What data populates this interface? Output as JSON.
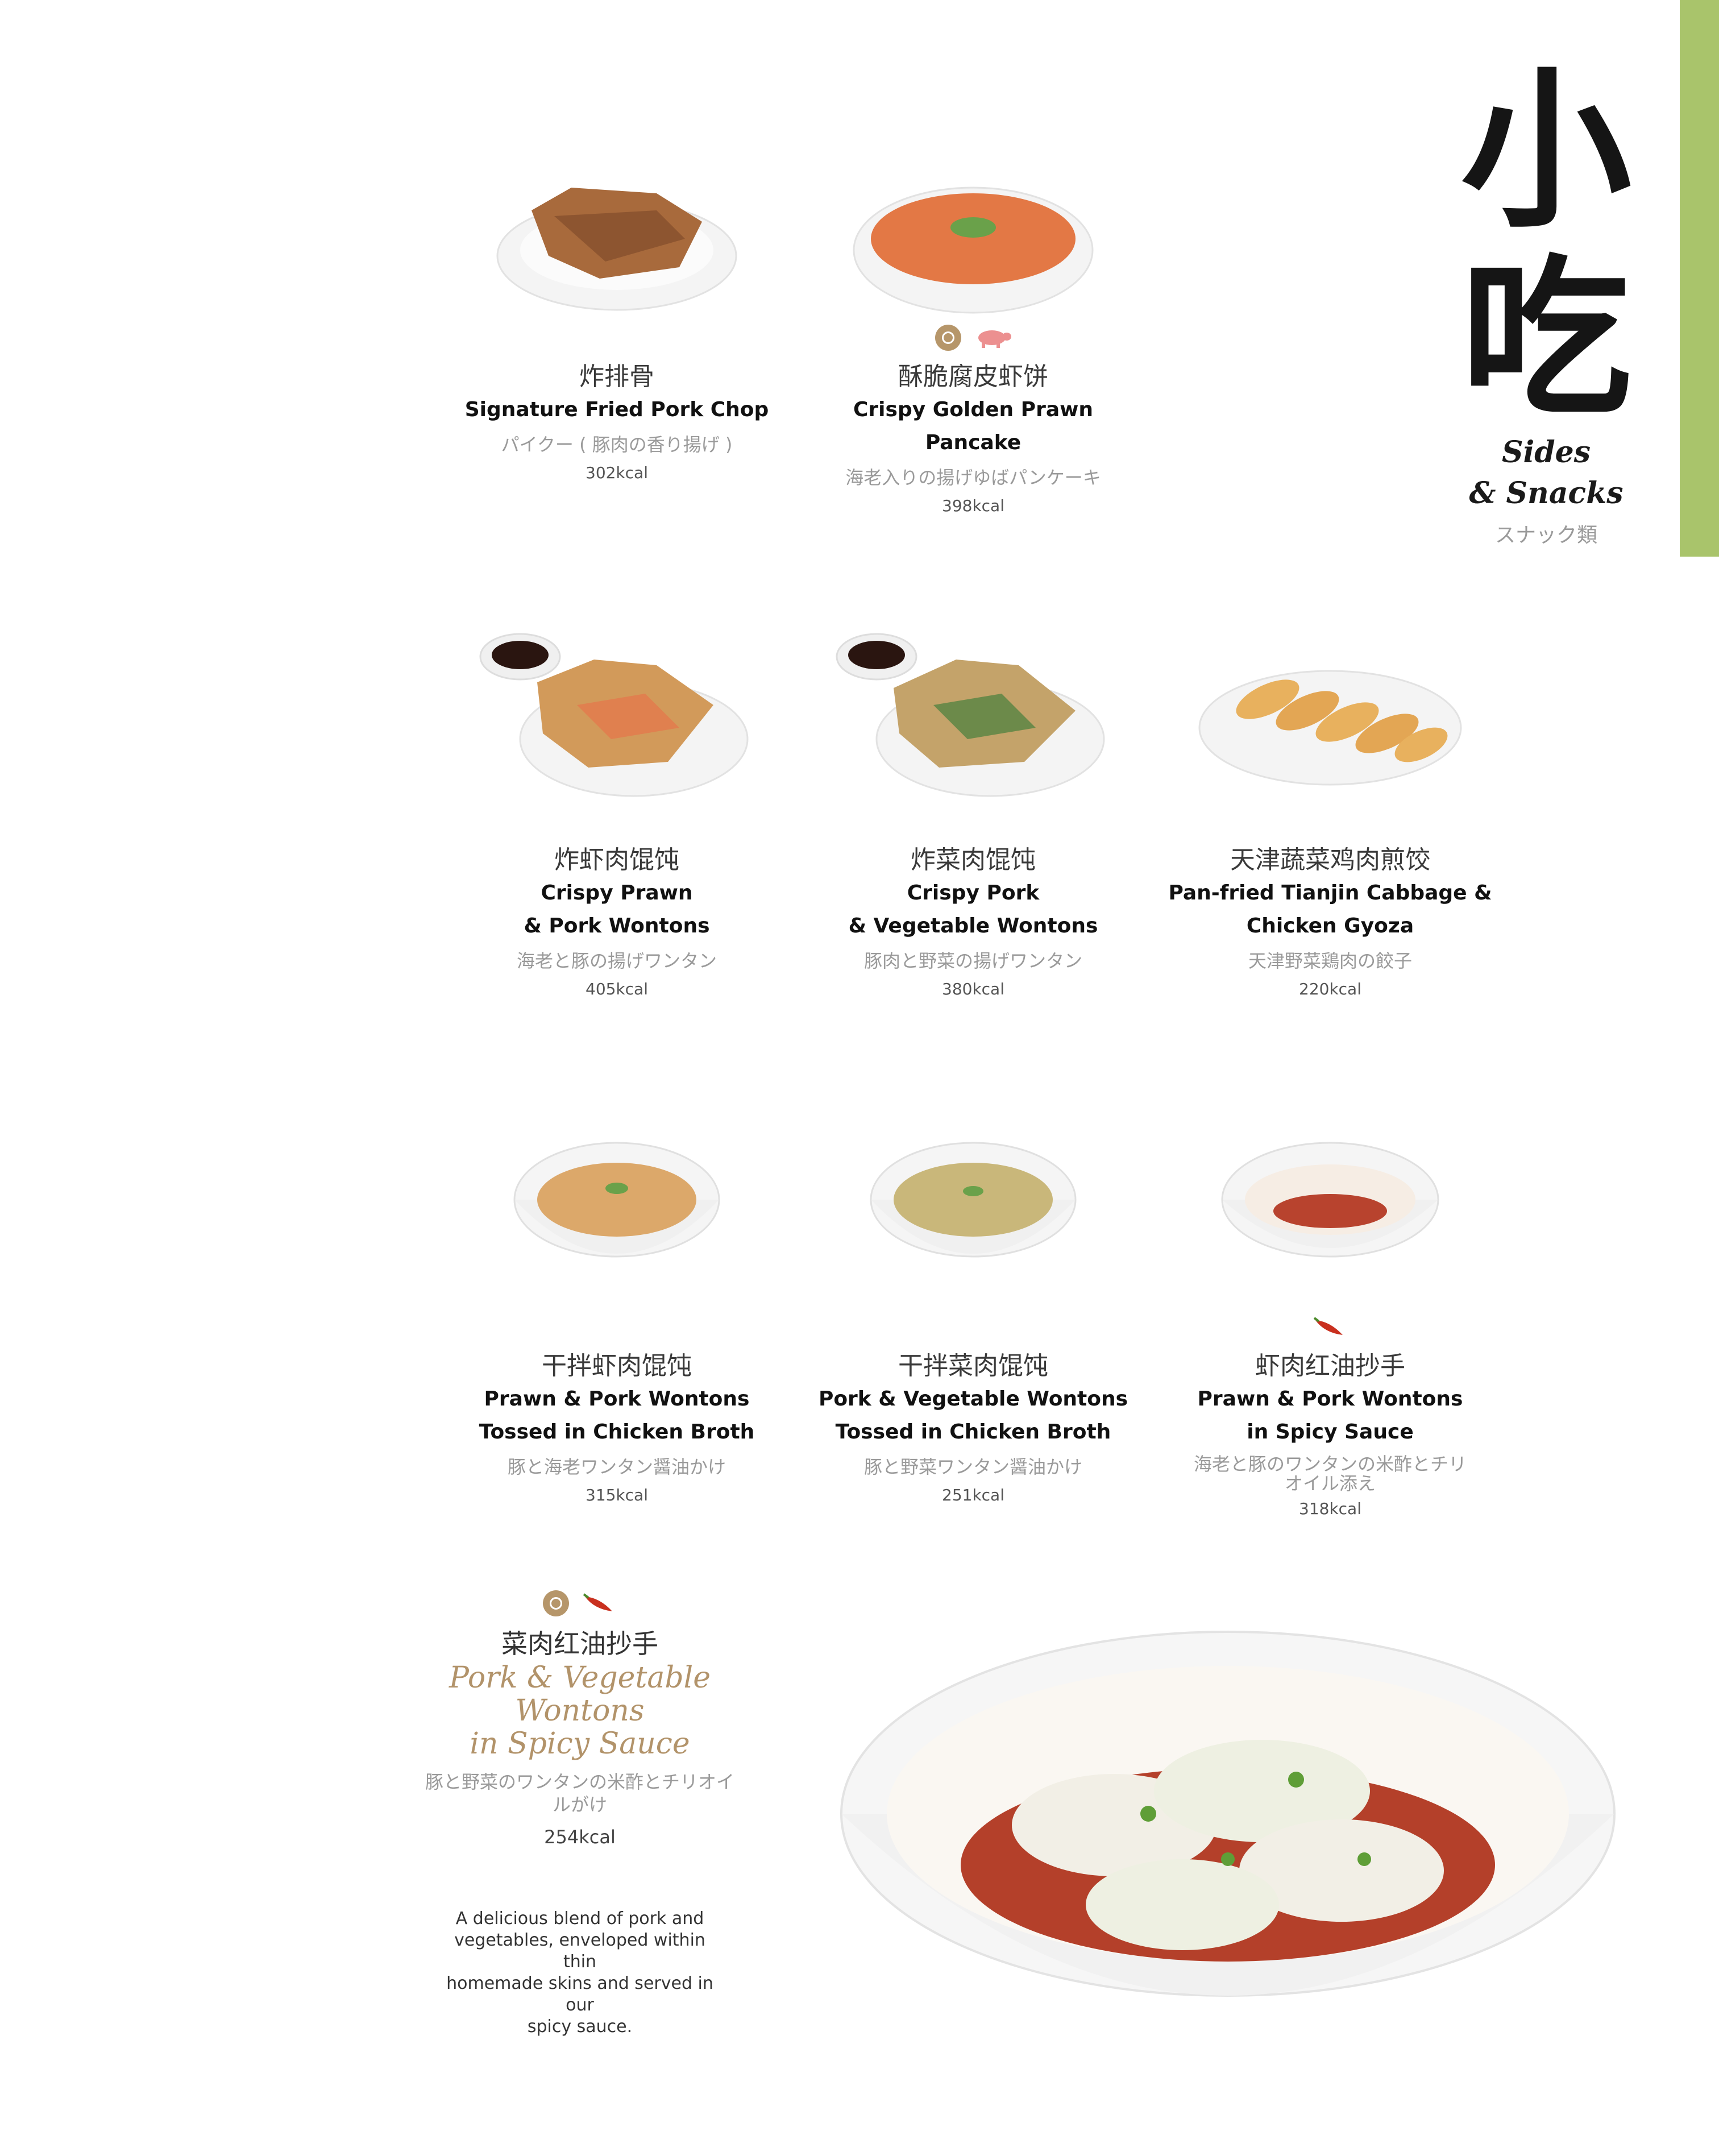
{
  "section": {
    "title_cn": "小吃",
    "title_en_line1": "Sides",
    "title_en_line2": "& Snacks",
    "title_jp": "スナック類",
    "accent_color": "#a9c46b"
  },
  "items": [
    {
      "cn": "炸排骨",
      "en": "Signature Fried Pork Chop",
      "jp": "パイクー ( 豚肉の香り揚げ )",
      "kcal": "302kcal",
      "badges": []
    },
    {
      "cn": "酥脆腐皮虾饼",
      "en": "Crispy Golden Prawn Pancake",
      "jp": "海老入りの揚げゆばパンケーキ",
      "kcal": "398kcal",
      "badges": [
        "signature-icon",
        "pork-icon"
      ]
    },
    {
      "cn": "炸虾肉馄饨",
      "en_line1": "Crispy Prawn",
      "en_line2": "& Pork Wontons",
      "jp": "海老と豚の揚げワンタン",
      "kcal": "405kcal",
      "badges": []
    },
    {
      "cn": "炸菜肉馄饨",
      "en_line1": "Crispy Pork",
      "en_line2": "& Vegetable Wontons",
      "jp": "豚肉と野菜の揚げワンタン",
      "kcal": "380kcal",
      "badges": []
    },
    {
      "cn": "天津蔬菜鸡肉煎饺",
      "en_line1": "Pan-fried Tianjin Cabbage &",
      "en_line2": "Chicken Gyoza",
      "jp": "天津野菜鶏肉の餃子",
      "kcal": "220kcal",
      "badges": []
    },
    {
      "cn": "干拌虾肉馄饨",
      "en_line1": "Prawn & Pork Wontons",
      "en_line2": "Tossed in Chicken Broth",
      "jp": "豚と海老ワンタン醤油かけ",
      "kcal": "315kcal",
      "badges": []
    },
    {
      "cn": "干拌菜肉馄饨",
      "en_line1": "Pork & Vegetable Wontons",
      "en_line2": "Tossed in Chicken Broth",
      "jp": "豚と野菜ワンタン醤油かけ",
      "kcal": "251kcal",
      "badges": []
    },
    {
      "cn": "虾肉红油抄手",
      "en_line1": "Prawn & Pork Wontons",
      "en_line2": "in Spicy Sauce",
      "jp_line1": "海老と豚のワンタンの米酢とチリ",
      "jp_line2": "オイル添え",
      "kcal": "318kcal",
      "badges": [
        "chili-icon"
      ]
    }
  ],
  "feature": {
    "cn": "菜肉红油抄手",
    "en_line1": "Pork & Vegetable Wontons",
    "en_line2": "in Spicy Sauce",
    "jp_line1": "豚と野菜のワンタンの米酢とチリオイ",
    "jp_line2": "ルがけ",
    "kcal": "254kcal",
    "desc_line1": "A delicious blend of pork and",
    "desc_line2": "vegetables, enveloped within thin",
    "desc_line3": "homemade skins and served in our",
    "desc_line4": "spicy sauce.",
    "badges": [
      "signature-icon",
      "chili-icon"
    ],
    "accent_color": "#b2936a"
  }
}
